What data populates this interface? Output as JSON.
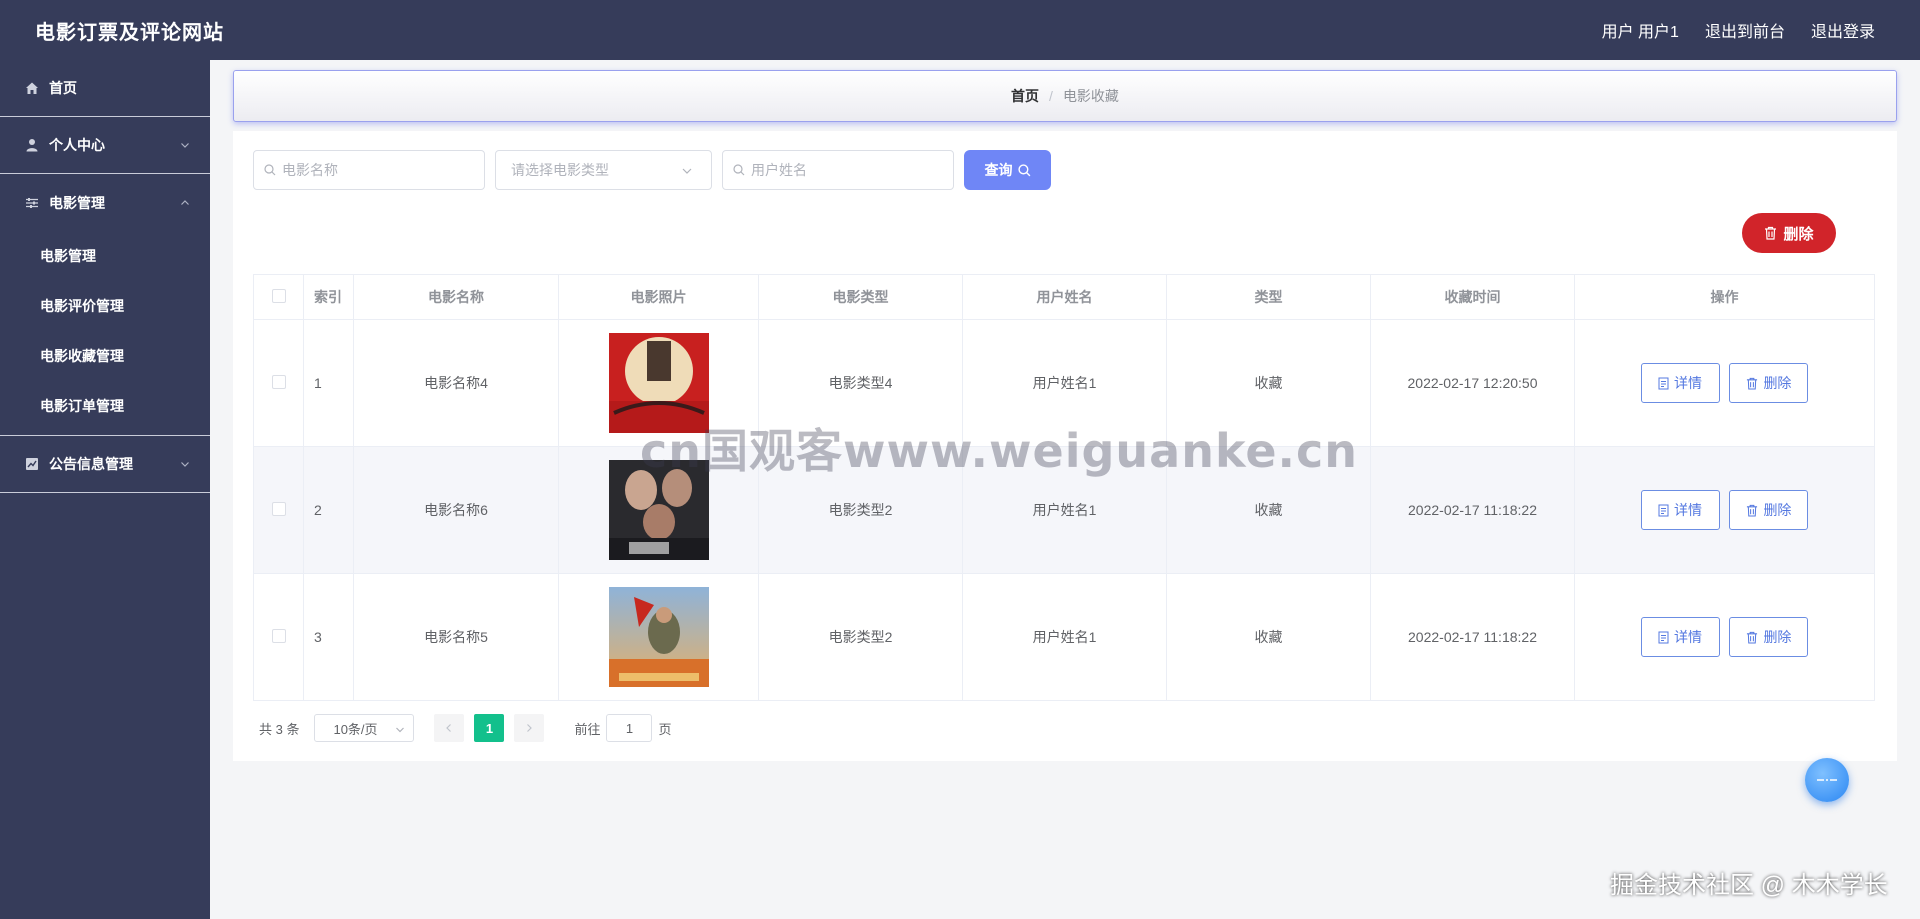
{
  "header": {
    "title": "电影订票及评论网站",
    "user_label": "用户 用户1",
    "back_front": "退出到前台",
    "logout": "退出登录"
  },
  "sidebar": {
    "home": "首页",
    "personal": "个人中心",
    "movie_mgmt": "电影管理",
    "sub_items": [
      "电影管理",
      "电影评价管理",
      "电影收藏管理",
      "电影订单管理"
    ],
    "notice": "公告信息管理"
  },
  "breadcrumb": {
    "home": "首页",
    "separator": "/",
    "current": "电影收藏"
  },
  "search": {
    "movie_name_placeholder": "电影名称",
    "movie_type_placeholder": "请选择电影类型",
    "user_name_placeholder": "用户姓名",
    "query_label": "查询"
  },
  "toolbar": {
    "delete_label": "删除"
  },
  "table": {
    "headers": [
      "索引",
      "电影名称",
      "电影照片",
      "电影类型",
      "用户姓名",
      "类型",
      "收藏时间",
      "操作"
    ],
    "rows": [
      {
        "index": "1",
        "name": "电影名称4",
        "poster": "red-poster",
        "type": "电影类型4",
        "user": "用户姓名1",
        "kind": "收藏",
        "time": "2022-02-17 12:20:50"
      },
      {
        "index": "2",
        "name": "电影名称6",
        "poster": "dark-poster",
        "type": "电影类型2",
        "user": "用户姓名1",
        "kind": "收藏",
        "time": "2022-02-17 11:18:22"
      },
      {
        "index": "3",
        "name": "电影名称5",
        "poster": "war-poster",
        "type": "电影类型2",
        "user": "用户姓名1",
        "kind": "收藏",
        "time": "2022-02-17 11:18:22"
      }
    ],
    "detail_label": "详情",
    "delete_label": "删除"
  },
  "pagination": {
    "total": "共 3 条",
    "page_size": "10条/页",
    "current_page": "1",
    "goto_prefix": "前往",
    "goto_value": "1",
    "goto_suffix": "页"
  },
  "watermark": "cn国观客www.weiguanke.cn",
  "credit": "掘金技术社区 @ 木木学长",
  "colors": {
    "header_bg": "#363c5a",
    "query_btn": "#6f86f6",
    "delete_btn": "#d1242a",
    "page_active": "#13c08c",
    "op_btn": "#5478e0"
  }
}
